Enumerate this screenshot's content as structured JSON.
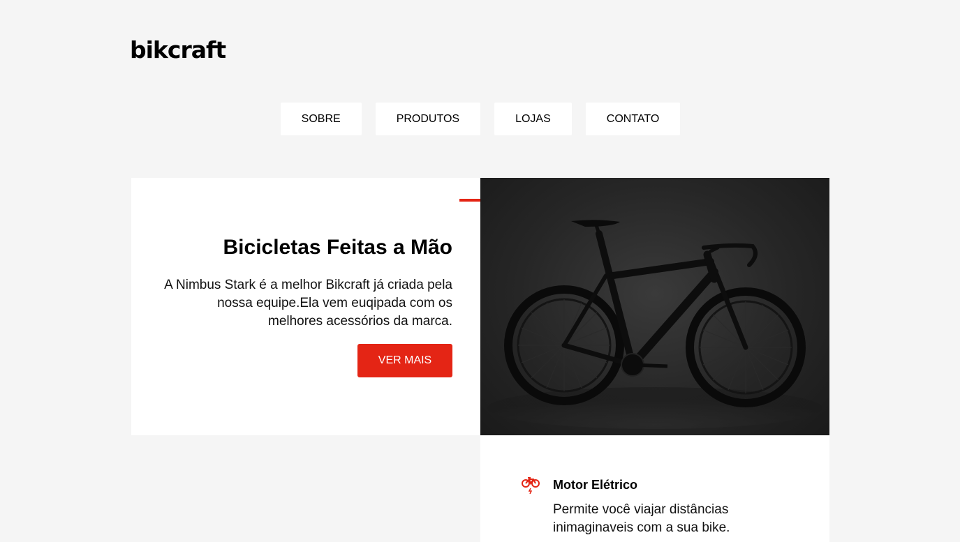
{
  "header": {
    "logo": "bikcraft"
  },
  "nav": {
    "items": [
      {
        "label": "SOBRE"
      },
      {
        "label": "PRODUTOS"
      },
      {
        "label": "LOJAS"
      },
      {
        "label": "CONTATO"
      }
    ]
  },
  "intro": {
    "title": "Bicicletas Feitas a Mão",
    "description": "A Nimbus Stark é a melhor Bikcraft já criada pela nossa equipe.Ela vem euqipada com os melhores acessórios da marca.",
    "cta_label": "VER MAIS"
  },
  "hero": {
    "image_icon": "bicycle-photo"
  },
  "features": {
    "items": [
      {
        "icon": "electric-bike-icon",
        "title": "Motor Elétrico",
        "description": "Permite você viajar distâncias inimaginaveis com a sua bike."
      }
    ]
  },
  "colors": {
    "accent": "#e42515",
    "background": "#f5f5f5",
    "surface": "#ffffff"
  }
}
